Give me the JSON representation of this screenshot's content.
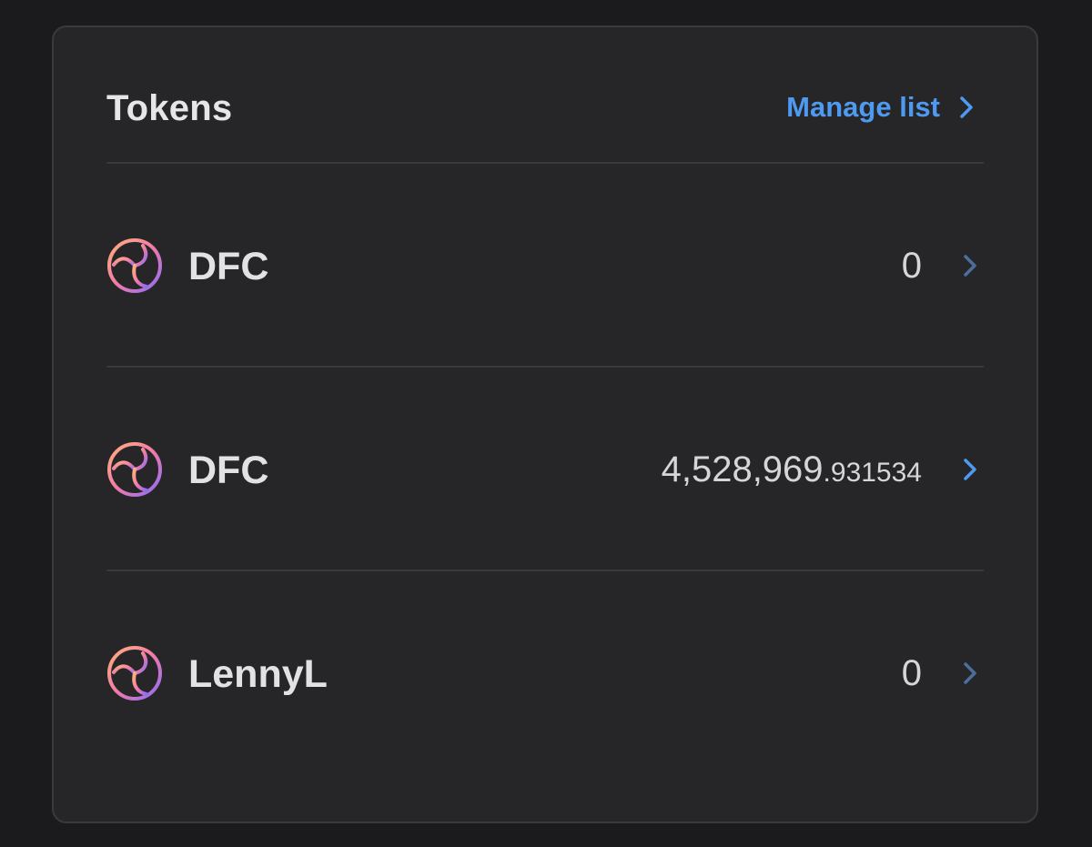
{
  "header": {
    "title": "Tokens",
    "manage_label": "Manage list"
  },
  "tokens": [
    {
      "name": "DFC",
      "balance_int": "0",
      "balance_dec": "",
      "icon": "token-logo-icon",
      "chevron_color": "#4a6f9a"
    },
    {
      "name": "DFC",
      "balance_int": "4,528,969",
      "balance_dec": ".931534",
      "icon": "token-logo-icon",
      "chevron_color": "#4e9af0"
    },
    {
      "name": "LennyL",
      "balance_int": "0",
      "balance_dec": "",
      "icon": "token-logo-icon",
      "chevron_color": "#4a6f9a"
    }
  ],
  "colors": {
    "accent": "#4e9af0",
    "background": "#1b1b1d",
    "card": "#262629"
  }
}
